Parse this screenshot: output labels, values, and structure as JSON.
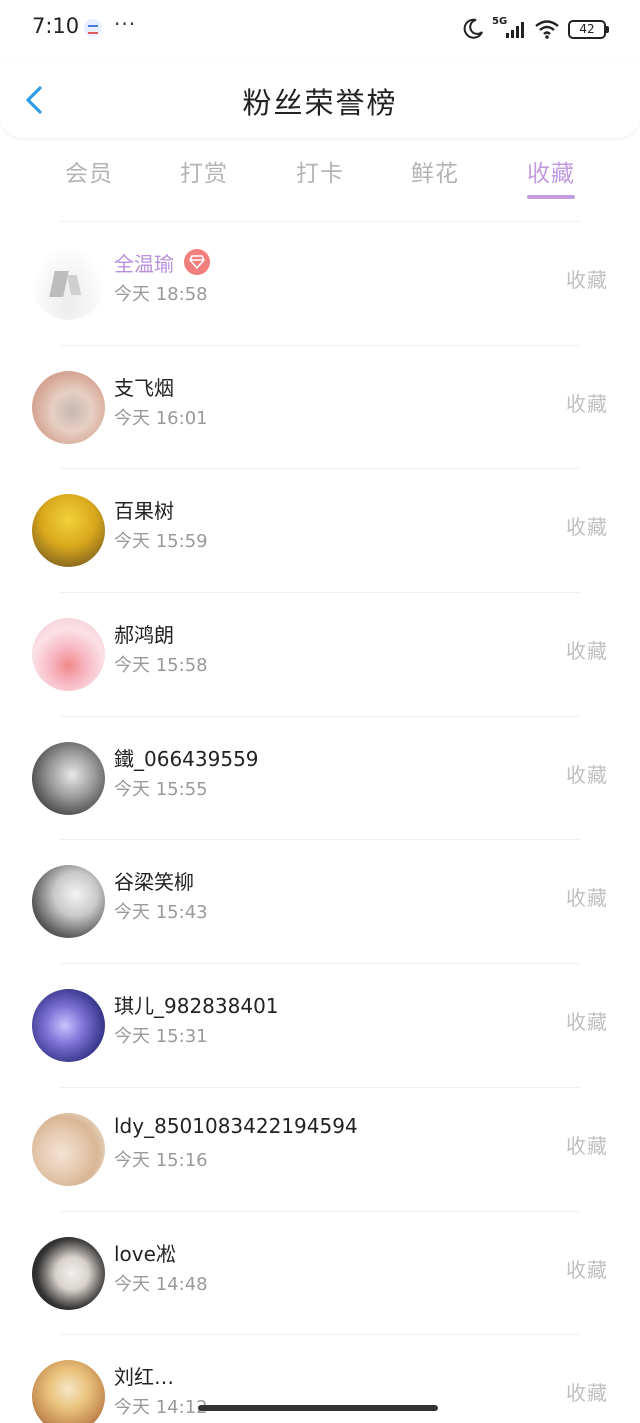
{
  "status_bar": {
    "time": "7:10",
    "dots": "···",
    "network": "5G",
    "battery": "42",
    "icons": [
      "moon-icon",
      "signal-icon",
      "wifi-icon",
      "battery-icon"
    ]
  },
  "header": {
    "title": "粉丝荣誉榜",
    "back_icon": "chevron-left-icon"
  },
  "tabs": [
    {
      "label": "会员",
      "active": false
    },
    {
      "label": "打赏",
      "active": false
    },
    {
      "label": "打卡",
      "active": false
    },
    {
      "label": "鲜花",
      "active": false
    },
    {
      "label": "收藏",
      "active": true
    }
  ],
  "theme": {
    "accent": "#c29be0",
    "vip_name": "#b98fdc",
    "badge": "#f37e7e",
    "muted": "#9a9a9a"
  },
  "fans": [
    {
      "name": "全温瑜",
      "time": "今天 18:58",
      "action": "收藏",
      "vip": true
    },
    {
      "name": "支飞烟",
      "time": "今天 16:01",
      "action": "收藏",
      "vip": false
    },
    {
      "name": "百果树",
      "time": "今天 15:59",
      "action": "收藏",
      "vip": false
    },
    {
      "name": "郝鸿朗",
      "time": "今天 15:58",
      "action": "收藏",
      "vip": false
    },
    {
      "name": "鐵_066439559",
      "time": "今天 15:55",
      "action": "收藏",
      "vip": false
    },
    {
      "name": "谷梁笑柳",
      "time": "今天 15:43",
      "action": "收藏",
      "vip": false
    },
    {
      "name": "琪儿_982838401",
      "time": "今天 15:31",
      "action": "收藏",
      "vip": false
    },
    {
      "name": "ldy_8501083422194594",
      "time": "今天 15:16",
      "action": "收藏",
      "vip": false
    },
    {
      "name": "love凇",
      "time": "今天 14:48",
      "action": "收藏",
      "vip": false
    },
    {
      "name": "刘红…",
      "time": "今天 14:12",
      "action": "收藏",
      "vip": false
    }
  ]
}
